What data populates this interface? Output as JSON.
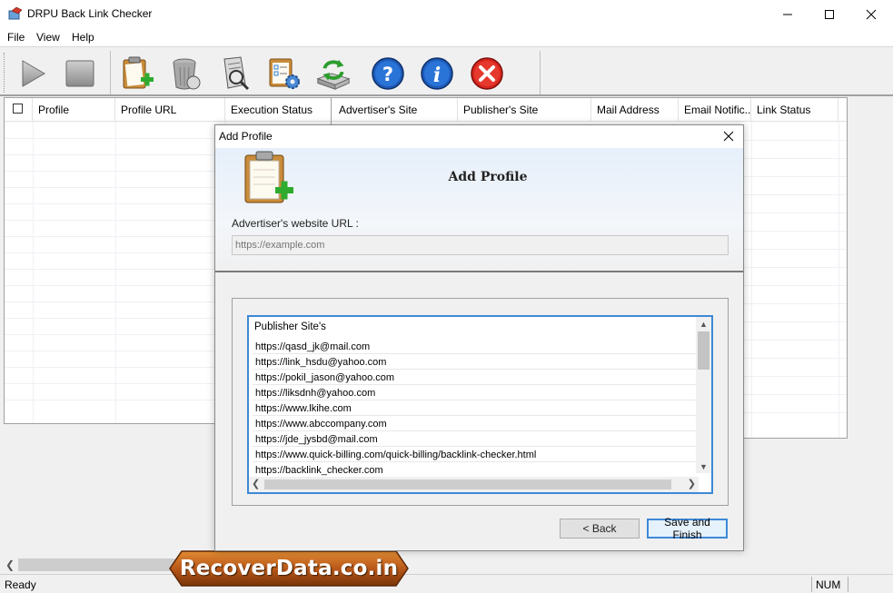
{
  "window": {
    "title": "DRPU Back Link Checker",
    "minimize_icon": "minimize-icon",
    "maximize_icon": "maximize-icon",
    "close_icon": "close-icon"
  },
  "menu": [
    "File",
    "View",
    "Help"
  ],
  "toolbar": {
    "buttons": [
      {
        "name": "play-button",
        "icon": "play-icon"
      },
      {
        "name": "stop-button",
        "icon": "stop-icon"
      },
      {
        "name": "add-profile-button",
        "icon": "clipboard-add-icon"
      },
      {
        "name": "delete-button",
        "icon": "trash-icon"
      },
      {
        "name": "report-button",
        "icon": "document-search-icon"
      },
      {
        "name": "settings-button",
        "icon": "checklist-gear-icon"
      },
      {
        "name": "update-button",
        "icon": "refresh-drive-icon"
      },
      {
        "name": "help-button",
        "icon": "help-icon"
      },
      {
        "name": "about-button",
        "icon": "info-icon"
      },
      {
        "name": "exit-button",
        "icon": "exit-icon"
      }
    ]
  },
  "left_grid": {
    "columns": [
      "Profile",
      "Profile URL",
      "Execution Status"
    ]
  },
  "right_grid": {
    "columns": [
      "Advertiser's Site",
      "Publisher's Site",
      "Mail Address",
      "Email Notific...",
      "Link Status"
    ]
  },
  "dialog": {
    "title": "Add Profile",
    "heading": "Add Profile",
    "url_label": "Advertiser's website URL :",
    "url_placeholder": "https://example.com",
    "list_header": "Publisher Site's",
    "publishers": [
      "https://qasd_jk@mail.com",
      "https://link_hsdu@yahoo.com",
      "https://pokil_jason@yahoo.com",
      "https://liksdnh@yahoo.com",
      "https://www.lkihe.com",
      "https://www.abccompany.com",
      "https://jde_jysbd@mail.com",
      "https://www.quick-billing.com/quick-billing/backlink-checker.html",
      "https://backlink_checker.com"
    ],
    "back_label": "< Back",
    "finish_label": "Save and Finish"
  },
  "statusbar": {
    "status": "Ready",
    "num": "NUM"
  },
  "watermark": "RecoverData.co.in",
  "colors": {
    "accent_blue": "#3d89d6",
    "banner_orange": "#c0661a",
    "exit_red": "#d7261e",
    "help_blue": "#1e5bb8"
  }
}
